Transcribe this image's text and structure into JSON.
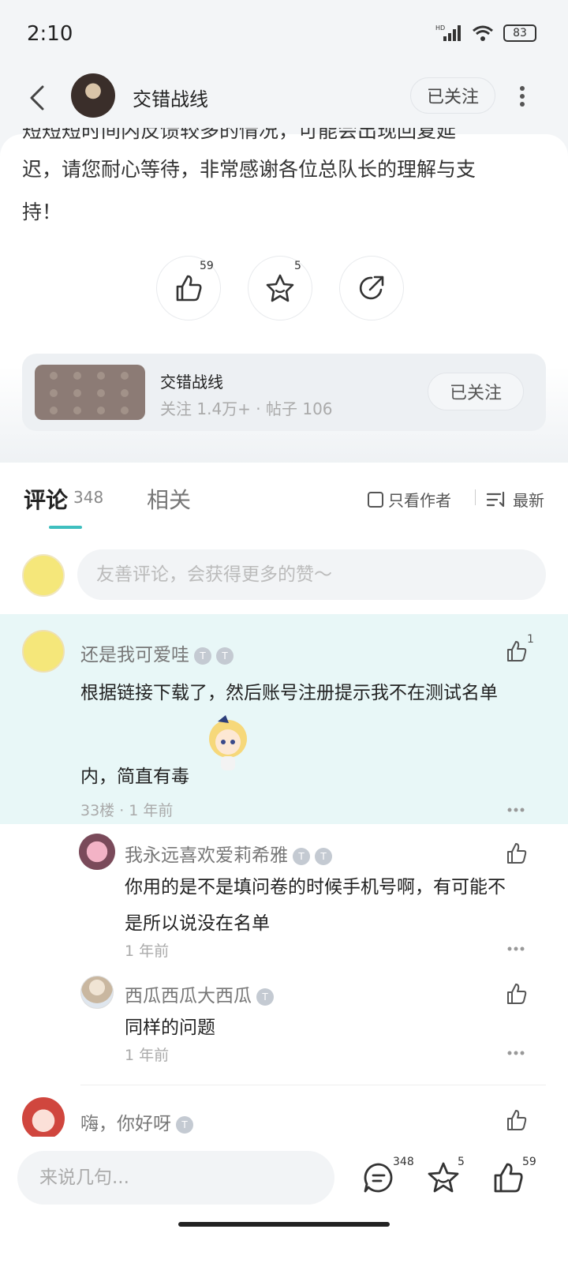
{
  "status": {
    "time": "2:10",
    "battery": "83",
    "network": "HD"
  },
  "header": {
    "title": "交错战线",
    "follow_label": "已关注"
  },
  "post": {
    "clipped_line": "短短短时间内反馈较多的情况，可能会出现回复延",
    "line1": "迟，请您耐心等待，非常感谢各位总队长的理解与支",
    "line2": "持！",
    "like_count": "59",
    "fav_count": "5"
  },
  "forum": {
    "name": "交错战线",
    "stats": "关注 1.4万+ · 帖子 106",
    "follow_label": "已关注"
  },
  "comments": {
    "tab_label": "评论",
    "count": "348",
    "related_label": "相关",
    "only_author_label": "只看作者",
    "sort_label": "最新",
    "input_placeholder": "友善评论，会获得更多的赞～",
    "items": [
      {
        "name": "还是我可爱哇",
        "text1": "根据链接下载了，然后账号注册提示我不在测试名单",
        "text2": "内，简直有毒",
        "meta": "33楼 · 1 年前",
        "likes": "1"
      },
      {
        "name": "我永远喜欢爱莉希雅",
        "text1": "你用的是不是填问卷的时候手机号啊，有可能不",
        "text2": "是所以说没在名单",
        "meta": "1 年前"
      },
      {
        "name": "西瓜西瓜大西瓜",
        "text1": "同样的问题",
        "meta": "1 年前"
      },
      {
        "name": "嗨，你好呀"
      }
    ]
  },
  "bottom": {
    "input_placeholder": "来说几句...",
    "comment_count": "348",
    "fav_count": "5",
    "like_count": "59"
  },
  "colors": {
    "accent": "#3fbfbf",
    "highlight_bg": "#e8f7f7"
  }
}
